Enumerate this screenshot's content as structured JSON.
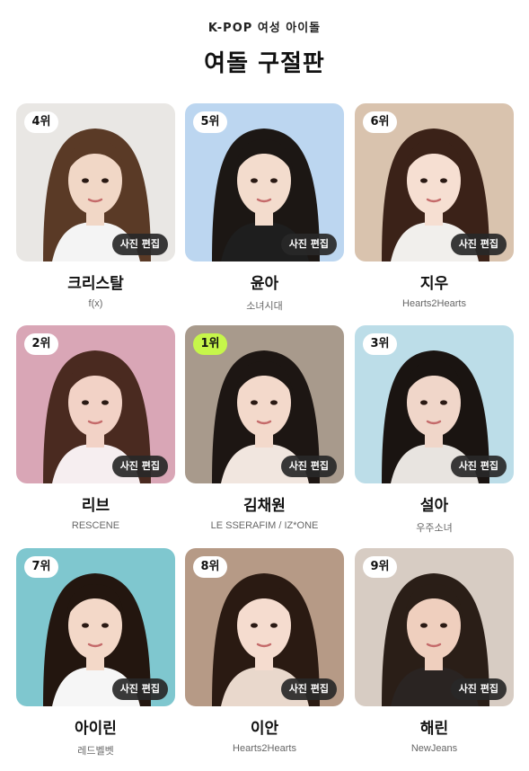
{
  "header": {
    "subtitle": "K-POP 여성 아이돌",
    "title": "여돌 구절판"
  },
  "edit_label": "사진 편집",
  "accent_color": "#c6f64a",
  "cards": [
    {
      "rank": "4위",
      "name": "크리스탈",
      "group": "f(x)",
      "highlight": false,
      "bg": "#e9e7e4",
      "hair": "#5a3a26",
      "skin": "#f1d7c6",
      "top": "#f4f4f4"
    },
    {
      "rank": "5위",
      "name": "윤아",
      "group": "소녀시대",
      "highlight": false,
      "bg": "#bcd6f0",
      "hair": "#1c1714",
      "skin": "#f3dccd",
      "top": "#1e1e1e"
    },
    {
      "rank": "6위",
      "name": "지우",
      "group": "Hearts2Hearts",
      "highlight": false,
      "bg": "#d9c3ae",
      "hair": "#3b2218",
      "skin": "#f6dfd2",
      "top": "#f1efec"
    },
    {
      "rank": "2위",
      "name": "리브",
      "group": "RESCENE",
      "highlight": false,
      "bg": "#d9a6b6",
      "hair": "#4a2a20",
      "skin": "#f2d2c6",
      "top": "#f6eef0"
    },
    {
      "rank": "1위",
      "name": "김채원",
      "group": "LE SSERAFIM / IZ*ONE",
      "highlight": true,
      "bg": "#a89a8c",
      "hair": "#1d1613",
      "skin": "#f3d9cb",
      "top": "#f1e6df"
    },
    {
      "rank": "3위",
      "name": "설아",
      "group": "우주소녀",
      "highlight": false,
      "bg": "#bcdde8",
      "hair": "#1a1411",
      "skin": "#f0d6c9",
      "top": "#e8e4e0"
    },
    {
      "rank": "7위",
      "name": "아이린",
      "group": "레드벨벳",
      "highlight": false,
      "bg": "#7fc7cf",
      "hair": "#23160f",
      "skin": "#f3d8c8",
      "top": "#f6f6f6"
    },
    {
      "rank": "8위",
      "name": "이안",
      "group": "Hearts2Hearts",
      "highlight": false,
      "bg": "#b69a86",
      "hair": "#2a1a12",
      "skin": "#f5dccf",
      "top": "#e9d8cc"
    },
    {
      "rank": "9위",
      "name": "해린",
      "group": "NewJeans",
      "highlight": false,
      "bg": "#d7ccc3",
      "hair": "#2a1e17",
      "skin": "#efcfbe",
      "top": "#2a2422"
    }
  ]
}
